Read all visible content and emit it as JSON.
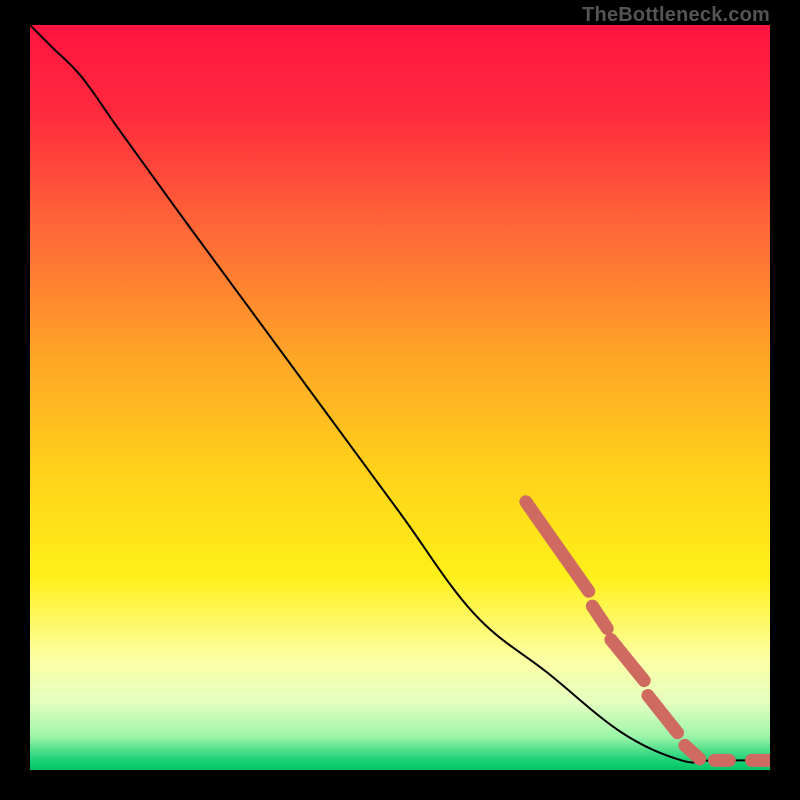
{
  "watermark": "TheBottleneck.com",
  "chart_data": {
    "type": "line",
    "title": "",
    "xlabel": "",
    "ylabel": "",
    "xlim": [
      0,
      100
    ],
    "ylim": [
      0,
      100
    ],
    "grid": false,
    "legend": false,
    "curve": {
      "name": "bottleneck-curve",
      "color": "#000000",
      "points": [
        {
          "x": 0,
          "y": 100
        },
        {
          "x": 3,
          "y": 97
        },
        {
          "x": 7,
          "y": 93
        },
        {
          "x": 12,
          "y": 86
        },
        {
          "x": 20,
          "y": 75
        },
        {
          "x": 30,
          "y": 61.5
        },
        {
          "x": 40,
          "y": 48
        },
        {
          "x": 50,
          "y": 34.5
        },
        {
          "x": 60,
          "y": 21
        },
        {
          "x": 70,
          "y": 13
        },
        {
          "x": 80,
          "y": 5
        },
        {
          "x": 88,
          "y": 1.3
        },
        {
          "x": 92,
          "y": 1.3
        },
        {
          "x": 96,
          "y": 1.3
        },
        {
          "x": 100,
          "y": 1.3
        }
      ]
    },
    "highlight_segments": {
      "name": "highlight-dots",
      "color": "#cf6a61",
      "segments": [
        {
          "x0": 67,
          "y0": 36,
          "x1": 75.5,
          "y1": 24
        },
        {
          "x0": 76,
          "y0": 22,
          "x1": 78,
          "y1": 19
        },
        {
          "x0": 78.5,
          "y0": 17.5,
          "x1": 83,
          "y1": 12
        },
        {
          "x0": 83.5,
          "y0": 10,
          "x1": 87.5,
          "y1": 5
        },
        {
          "x0": 88.5,
          "y0": 3.3,
          "x1": 90.5,
          "y1": 1.5
        },
        {
          "x0": 92.5,
          "y0": 1.3,
          "x1": 94.5,
          "y1": 1.3
        },
        {
          "x0": 97.5,
          "y0": 1.3,
          "x1": 100,
          "y1": 1.3
        }
      ]
    },
    "gradient_stops": [
      {
        "offset": 0.0,
        "color": "#ff1440"
      },
      {
        "offset": 0.12,
        "color": "#ff2b3e"
      },
      {
        "offset": 0.28,
        "color": "#ff6a37"
      },
      {
        "offset": 0.45,
        "color": "#ffa726"
      },
      {
        "offset": 0.6,
        "color": "#ffd21a"
      },
      {
        "offset": 0.74,
        "color": "#fff01a"
      },
      {
        "offset": 0.85,
        "color": "#fdffa3"
      },
      {
        "offset": 0.91,
        "color": "#e4ffc0"
      },
      {
        "offset": 0.955,
        "color": "#9cf5a8"
      },
      {
        "offset": 0.985,
        "color": "#22d27a"
      },
      {
        "offset": 1.0,
        "color": "#00c765"
      }
    ]
  }
}
